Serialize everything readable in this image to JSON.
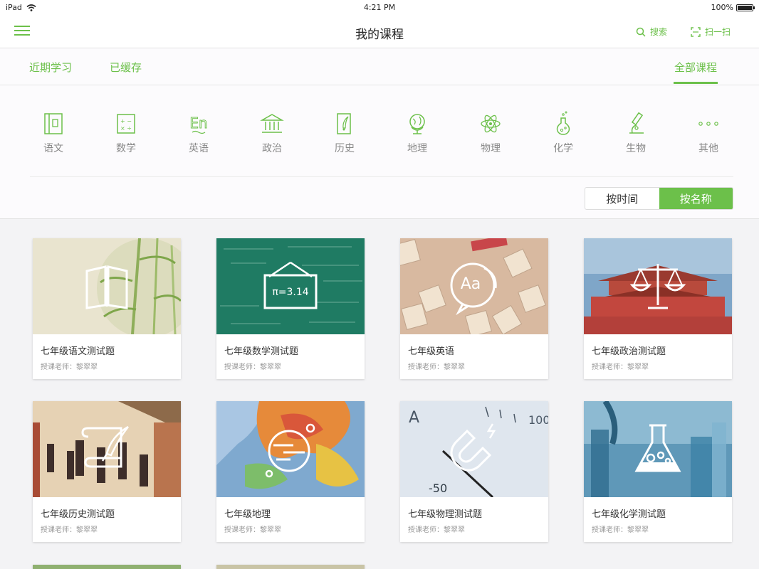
{
  "status": {
    "device": "iPad",
    "time": "4:21 PM",
    "battery": "100%"
  },
  "nav": {
    "title": "我的课程",
    "search_label": "搜索",
    "scan_label": "扫一扫"
  },
  "tabs": [
    {
      "label": "近期学习"
    },
    {
      "label": "已缓存"
    },
    {
      "label": "全部课程"
    }
  ],
  "subjects": [
    {
      "label": "语文"
    },
    {
      "label": "数学"
    },
    {
      "label": "英语"
    },
    {
      "label": "政治"
    },
    {
      "label": "历史"
    },
    {
      "label": "地理"
    },
    {
      "label": "物理"
    },
    {
      "label": "化学"
    },
    {
      "label": "生物"
    },
    {
      "label": "其他"
    }
  ],
  "sort": {
    "by_time": "按时间",
    "by_name": "按名称",
    "selected": "by_name"
  },
  "courses": [
    {
      "title": "七年级语文测试题",
      "teacher": "授课老师：黎翠翠"
    },
    {
      "title": "七年级数学测试题",
      "teacher": "授课老师：黎翠翠",
      "board_text": "π=3.14"
    },
    {
      "title": "七年级英语",
      "teacher": "授课老师：黎翠翠",
      "bubble_text": "Aa"
    },
    {
      "title": "七年级政治测试题",
      "teacher": "授课老师：黎翠翠"
    },
    {
      "title": "七年级历史测试题",
      "teacher": "授课老师：黎翠翠"
    },
    {
      "title": "七年级地理",
      "teacher": "授课老师：黎翠翠"
    },
    {
      "title": "七年级物理测试题",
      "teacher": "授课老师：黎翠翠"
    },
    {
      "title": "七年级化学测试题",
      "teacher": "授课老师：黎翠翠"
    }
  ],
  "colors": {
    "accent": "#6cc04a",
    "page_bg": "#f3f3f5",
    "panel_bg": "#fcfbfd"
  }
}
